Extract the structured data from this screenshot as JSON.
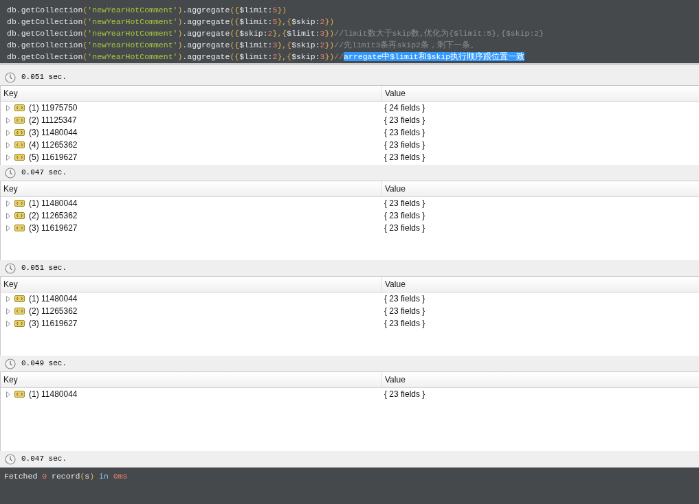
{
  "editor": {
    "lines": [
      [
        {
          "kind": "p",
          "text": "db.getCollection"
        },
        {
          "kind": "b",
          "text": "("
        },
        {
          "kind": "s",
          "text": "'newYearHotComment'"
        },
        {
          "kind": "b",
          "text": ")"
        },
        {
          "kind": "p",
          "text": ".aggregate"
        },
        {
          "kind": "b",
          "text": "({"
        },
        {
          "kind": "p",
          "text": "$limit:"
        },
        {
          "kind": "n",
          "text": "5"
        },
        {
          "kind": "b",
          "text": "})"
        }
      ],
      [
        {
          "kind": "p",
          "text": "db.getCollection"
        },
        {
          "kind": "b",
          "text": "("
        },
        {
          "kind": "s",
          "text": "'newYearHotComment'"
        },
        {
          "kind": "b",
          "text": ")"
        },
        {
          "kind": "p",
          "text": ".aggregate"
        },
        {
          "kind": "b",
          "text": "({"
        },
        {
          "kind": "p",
          "text": "$limit:"
        },
        {
          "kind": "n",
          "text": "5"
        },
        {
          "kind": "b",
          "text": "},{"
        },
        {
          "kind": "p",
          "text": "$skip:"
        },
        {
          "kind": "n",
          "text": "2"
        },
        {
          "kind": "b",
          "text": "})"
        }
      ],
      [
        {
          "kind": "p",
          "text": "db.getCollection"
        },
        {
          "kind": "b",
          "text": "("
        },
        {
          "kind": "s",
          "text": "'newYearHotComment'"
        },
        {
          "kind": "b",
          "text": ")"
        },
        {
          "kind": "p",
          "text": ".aggregate"
        },
        {
          "kind": "b",
          "text": "({"
        },
        {
          "kind": "p",
          "text": "$skip:"
        },
        {
          "kind": "n",
          "text": "2"
        },
        {
          "kind": "b",
          "text": "},{"
        },
        {
          "kind": "p",
          "text": "$limit:"
        },
        {
          "kind": "n",
          "text": "3"
        },
        {
          "kind": "b",
          "text": "})"
        },
        {
          "kind": "c",
          "text": "//limit数大于skip数,优化为{$limit:5},{$skip:2}"
        }
      ],
      [
        {
          "kind": "p",
          "text": "db.getCollection"
        },
        {
          "kind": "b",
          "text": "("
        },
        {
          "kind": "s",
          "text": "'newYearHotComment'"
        },
        {
          "kind": "b",
          "text": ")"
        },
        {
          "kind": "p",
          "text": ".aggregate"
        },
        {
          "kind": "b",
          "text": "({"
        },
        {
          "kind": "p",
          "text": "$limit:"
        },
        {
          "kind": "n",
          "text": "3"
        },
        {
          "kind": "b",
          "text": "},{"
        },
        {
          "kind": "p",
          "text": "$skip:"
        },
        {
          "kind": "n",
          "text": "2"
        },
        {
          "kind": "b",
          "text": "})"
        },
        {
          "kind": "c",
          "text": "//先limit3条再skip2条，剩下一条。"
        }
      ],
      [
        {
          "kind": "p",
          "text": "db.getCollection"
        },
        {
          "kind": "b",
          "text": "("
        },
        {
          "kind": "s",
          "text": "'newYearHotComment'"
        },
        {
          "kind": "b",
          "text": ")"
        },
        {
          "kind": "p",
          "text": ".aggregate"
        },
        {
          "kind": "b",
          "text": "({"
        },
        {
          "kind": "p",
          "text": "$limit:"
        },
        {
          "kind": "n",
          "text": "2"
        },
        {
          "kind": "b",
          "text": "},{"
        },
        {
          "kind": "p",
          "text": "$skip:"
        },
        {
          "kind": "n",
          "text": "3"
        },
        {
          "kind": "b",
          "text": "})"
        },
        {
          "kind": "c",
          "text": "//"
        },
        {
          "kind": "h",
          "text": "arregate中$limit和$skip执行顺序跟位置一致"
        }
      ]
    ]
  },
  "results": [
    {
      "time": "0.051 sec.",
      "columns": [
        "Key",
        "Value"
      ],
      "rows": [
        {
          "key": "(1) 11975750",
          "value": "{ 24 fields }"
        },
        {
          "key": "(2) 11125347",
          "value": "{ 23 fields }"
        },
        {
          "key": "(3) 11480044",
          "value": "{ 23 fields }"
        },
        {
          "key": "(4) 11265362",
          "value": "{ 23 fields }"
        },
        {
          "key": "(5) 11619627",
          "value": "{ 23 fields }"
        }
      ]
    },
    {
      "time": "0.047 sec.",
      "columns": [
        "Key",
        "Value"
      ],
      "rows": [
        {
          "key": "(1) 11480044",
          "value": "{ 23 fields }"
        },
        {
          "key": "(2) 11265362",
          "value": "{ 23 fields }"
        },
        {
          "key": "(3) 11619627",
          "value": "{ 23 fields }"
        }
      ]
    },
    {
      "time": "0.051 sec.",
      "columns": [
        "Key",
        "Value"
      ],
      "rows": [
        {
          "key": "(1) 11480044",
          "value": "{ 23 fields }"
        },
        {
          "key": "(2) 11265362",
          "value": "{ 23 fields }"
        },
        {
          "key": "(3) 11619627",
          "value": "{ 23 fields }"
        }
      ]
    },
    {
      "time": "0.049 sec.",
      "columns": [
        "Key",
        "Value"
      ],
      "rows": [
        {
          "key": "(1) 11480044",
          "value": "{ 23 fields }"
        }
      ]
    },
    {
      "time": "0.047 sec."
    }
  ],
  "output": [
    {
      "kind": "p",
      "text": "Fetched "
    },
    {
      "kind": "n",
      "text": "0 "
    },
    {
      "kind": "p",
      "text": "record"
    },
    {
      "kind": "b",
      "text": "("
    },
    {
      "kind": "p",
      "text": "s"
    },
    {
      "kind": "b",
      "text": ") "
    },
    {
      "kind": "k",
      "text": "in "
    },
    {
      "kind": "n",
      "text": "0ms"
    }
  ]
}
